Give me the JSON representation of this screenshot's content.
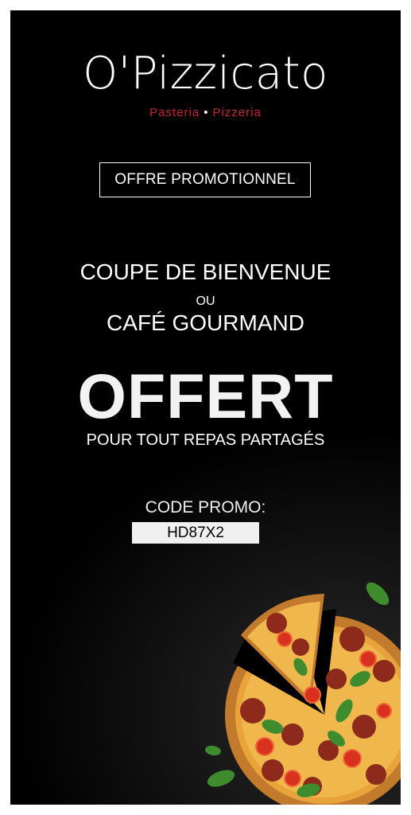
{
  "brand": {
    "name": "O'Pizzicato",
    "sub_left": "Pasteria",
    "sub_sep": "•",
    "sub_right": "Pizzeria",
    "accent": "#c0262b"
  },
  "badge": "OFFRE PROMOTIONNEL",
  "offer": {
    "line1": "COUPE DE BIENVENUE",
    "line2": "OU",
    "line3": "CAFÉ GOURMAND",
    "headline": "OFFERT",
    "condition": "POUR TOUT REPAS PARTAGÉS"
  },
  "promo": {
    "label": "CODE PROMO:",
    "code": "HD87X2"
  },
  "image": {
    "subject": "pizza-image"
  }
}
